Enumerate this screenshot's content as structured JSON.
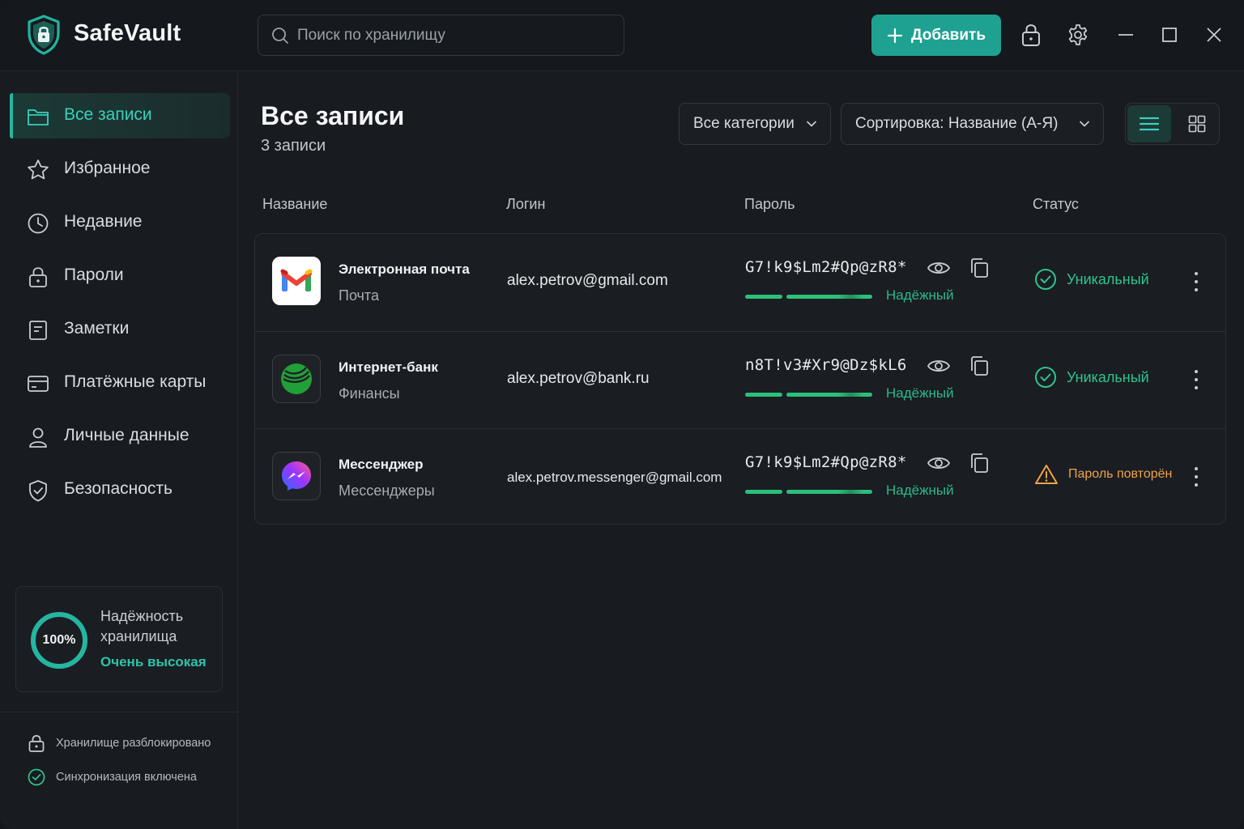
{
  "app": {
    "title": "SafeVault"
  },
  "header": {
    "search_placeholder": "Поиск по хранилищу",
    "add_label": "Добавить",
    "icons": [
      "lock-icon",
      "gear-icon",
      "minimize-icon",
      "maximize-icon",
      "close-icon"
    ]
  },
  "sidebar": {
    "items": [
      {
        "label": "Все записи",
        "icon": "folder-icon",
        "active": true
      },
      {
        "label": "Избранное",
        "icon": "star-icon"
      },
      {
        "label": "Недавние",
        "icon": "clock-icon"
      },
      {
        "label": "Пароли",
        "icon": "lock-icon"
      },
      {
        "label": "Заметки",
        "icon": "note-icon"
      },
      {
        "label": "Платёжные карты",
        "icon": "card-icon"
      },
      {
        "label": "Личные данные",
        "icon": "user-icon"
      },
      {
        "label": "Безопасность",
        "icon": "shield-check-icon"
      }
    ],
    "strength": {
      "percent_label": "100%",
      "percent": 100,
      "title": "Надёжность хранилища",
      "value": "Очень высокая"
    },
    "footer": {
      "unlocked": "Хранилище разблокировано",
      "sync": "Синхронизация включена"
    }
  },
  "main": {
    "title": "Все записи",
    "count": "3 записи",
    "filter_label": "Все категории",
    "sort_label": "Сортировка: Название (А-Я)",
    "columns": {
      "name": "Название",
      "login": "Логин",
      "password": "Пароль",
      "status": "Статус"
    },
    "rows": [
      {
        "name": "Электронная почта",
        "category": "Почта",
        "login": "alex.petrov@gmail.com",
        "password": "G7!k9$Lm2#Qp@zR8*",
        "strength": "Надёжный",
        "status": "Уникальный",
        "status_type": "ok",
        "icon": "gmail-icon"
      },
      {
        "name": "Интернет-банк",
        "category": "Финансы",
        "login": "alex.petrov@bank.ru",
        "password": "n8T!v3#Xr9@Dz$kL6",
        "strength": "Надёжный",
        "status": "Уникальный",
        "status_type": "ok",
        "icon": "bank-icon"
      },
      {
        "name": "Мессенджер",
        "category": "Мессенджеры",
        "login": "alex.petrov.messenger@gmail.com",
        "password": "G7!k9$Lm2#Qp@zR8*",
        "strength": "Надёжный",
        "status": "Пароль повторён",
        "status_type": "warn",
        "icon": "messenger-icon"
      }
    ]
  },
  "colors": {
    "accent": "#1fa191",
    "accent_text": "#39d0b9",
    "ok": "#2ec48f",
    "warn": "#f0a24a",
    "bg": "#181b1f"
  }
}
